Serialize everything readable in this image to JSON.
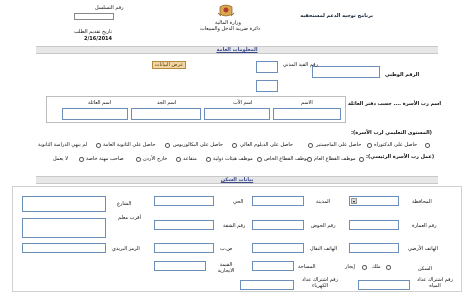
{
  "header": {
    "program_title": "برنامج توجيه الدعم لمستحقيه",
    "ministry": "وزارة المالية",
    "department": "دائرة ضريبة الدخل والمبيعات",
    "serial_label": "رقم التسلسل",
    "submit_date_label": "تاريخ تقديم الطلب",
    "submit_date": "2/16/2014"
  },
  "general_section": {
    "title": "المعلومات العامة",
    "show_button": "عرض البيانات",
    "national_id_label": "الرقم الوطني",
    "civil_record_label": "رقم القيد المدني"
  },
  "name_section": {
    "label": "اسم رب الأسرة .... حسب دفتر العائلة",
    "cols": [
      "الاسم",
      "اسم الأب",
      "اسم الجد",
      "اسم العائلة"
    ]
  },
  "education": {
    "label": "(المستوى التعليمي لرب الأسرة):",
    "options": [
      "حاصل على الدكتوراه",
      "حاصل على الماجستير",
      "حاصل على الدبلوم العالي",
      "حاصل على البكالوريوس",
      "حاصل على الثانوية العامة",
      "لم ينهي الدراسة الثانوية"
    ]
  },
  "work": {
    "label": "(عمل رب الأسرة الرئيسي):",
    "options": [
      "موظف القطاع العام",
      "موظف القطاع الخاص",
      "موظف هيئات دولية",
      "متقاعد",
      "خارج الأردن",
      "صاحب مهنة خاصة",
      "لا يعمل"
    ]
  },
  "housing": {
    "title": "بيانات السكن",
    "governorate": "المحافظة",
    "city": "المدينة",
    "district": "الحي",
    "street": "الشارع",
    "building_no": "رقم العمارة",
    "apartment_no": "رقم الشقة",
    "phone_label": "الهاتف الأرضي",
    "mobile_label": "الهاتف النقال",
    "po_box": "ص.ب",
    "postal_code": "الرمز البريدي",
    "ownership_label": "السكن",
    "owned": "ملك",
    "rented": "إيجار",
    "rent_value": "القيمة الايجارية",
    "area": "المساحة",
    "water_sub": "رقم اشتراك عداد المياه",
    "elec_sub": "رقم اشتراك عداد الكهرباء",
    "other_address": "أقرب معلم",
    "land_no": "رقم القطعة",
    "basin": "رقم الحوض"
  },
  "colors": {
    "accent_bar": "#e7e7e7",
    "input_border": "#6b8fb8",
    "button": "#f1d6a4"
  }
}
